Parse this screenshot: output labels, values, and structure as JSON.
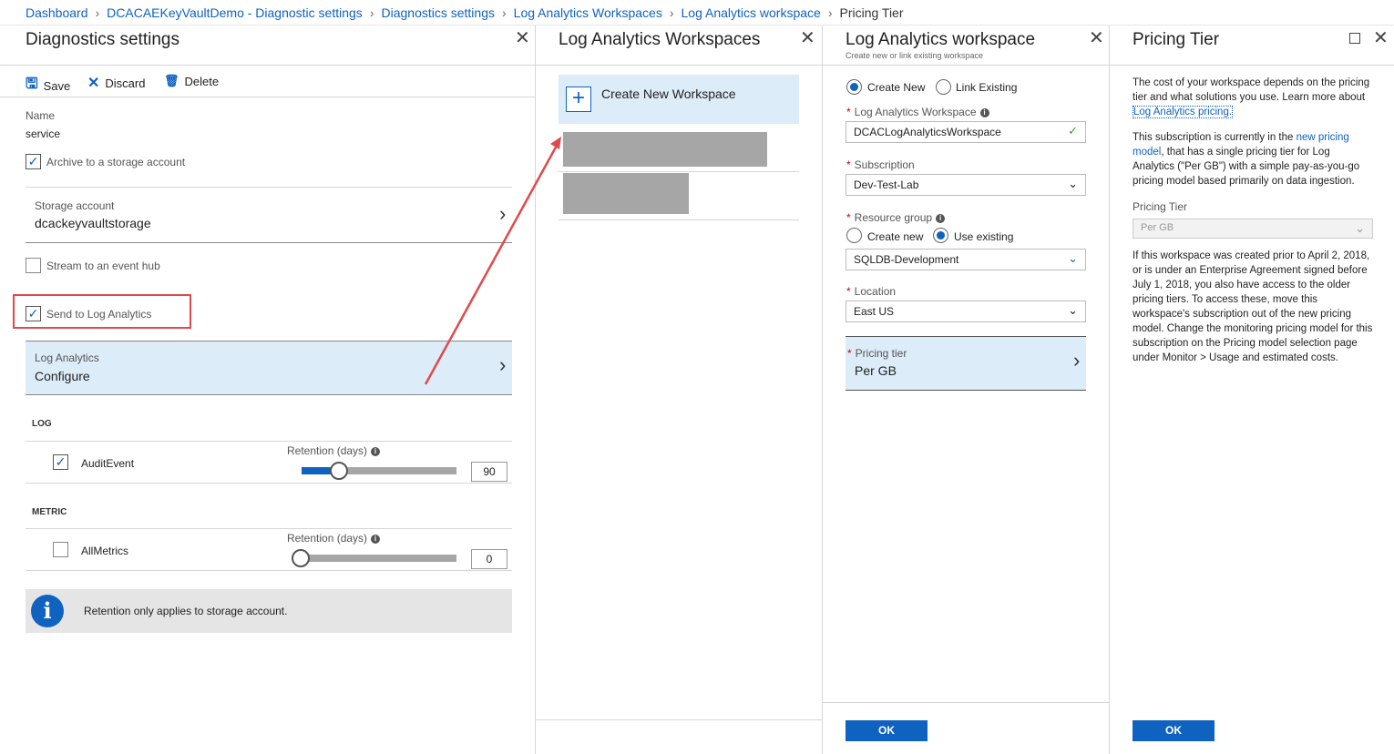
{
  "breadcrumb": {
    "items": [
      "Dashboard",
      "DCACAEKeyVaultDemo - Diagnostic settings",
      "Diagnostics settings",
      "Log Analytics Workspaces",
      "Log Analytics workspace"
    ],
    "current": "Pricing Tier"
  },
  "diagnostics": {
    "title": "Diagnostics settings",
    "toolbar": {
      "save": "Save",
      "discard": "Discard",
      "delete": "Delete"
    },
    "name_label": "Name",
    "name_value": "service",
    "archive_label": "Archive to a storage account",
    "archive_checked": true,
    "storage_label": "Storage account",
    "storage_value": "dcackeyvaultstorage",
    "stream_label": "Stream to an event hub",
    "stream_checked": false,
    "send_la_label": "Send to Log Analytics",
    "send_la_checked": true,
    "la_label": "Log Analytics",
    "la_value": "Configure",
    "log_section": "LOG",
    "metric_section": "METRIC",
    "audit": {
      "label": "AuditEvent",
      "retention_label": "Retention (days)",
      "value": "90",
      "checked": true
    },
    "metrics": {
      "label": "AllMetrics",
      "retention_label": "Retention (days)",
      "value": "0",
      "checked": false
    },
    "info_text": "Retention only applies to storage account."
  },
  "workspaces": {
    "title": "Log Analytics Workspaces",
    "create_new": "Create New Workspace"
  },
  "workspace": {
    "title": "Log Analytics workspace",
    "subtitle": "Create new or link existing workspace",
    "create_new": "Create New",
    "link_existing": "Link Existing",
    "ws_label": "Log Analytics Workspace",
    "ws_value": "DCACLogAnalyticsWorkspace",
    "sub_label": "Subscription",
    "sub_value": "Dev-Test-Lab",
    "rg_label": "Resource group",
    "rg_create": "Create new",
    "rg_existing": "Use existing",
    "rg_value": "SQLDB-Development",
    "loc_label": "Location",
    "loc_value": "East US",
    "tier_label": "Pricing tier",
    "tier_value": "Per GB",
    "ok": "OK"
  },
  "pricing": {
    "title": "Pricing Tier",
    "para1_a": "The cost of your workspace depends on the pricing tier and what solutions you use. Learn more about",
    "para1_link": "Log Analytics pricing.",
    "para2_a": "This subscription is currently in the",
    "para2_link": "new pricing model",
    "para2_b": ", that has a single pricing tier for Log Analytics (\"Per GB\") with a simple pay-as-you-go pricing model based primarily on data ingestion.",
    "tier_label": "Pricing Tier",
    "tier_value": "Per GB",
    "para3": "If this workspace was created prior to April 2, 2018, or is under an Enterprise Agreement signed before July 1, 2018, you also have access to the older pricing tiers. To access these, move this workspace's subscription out of the new pricing model. Change the monitoring pricing model for this subscription on the Pricing model selection page under Monitor > Usage and estimated costs.",
    "ok": "OK"
  }
}
